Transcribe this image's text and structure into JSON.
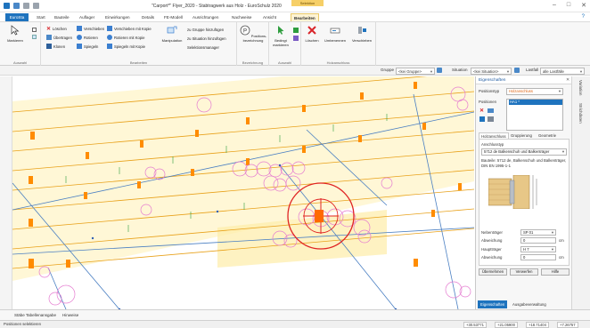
{
  "window": {
    "title": "\"Carport*\" Flyer_2020  -  Stabtragwerk aus Holz - EuroSchulz 2020",
    "context_tab_group": "Selektion"
  },
  "ribbon_tabs": [
    "EuroSta",
    "Start",
    "Bauteile",
    "Auflager",
    "Einwirkungen",
    "Details",
    "FE-Modell",
    "Ausrichtungen",
    "Nachweise",
    "Ansicht",
    "Bearbeiten"
  ],
  "ribbon": {
    "auswahl": {
      "markieren": "Markieren",
      "label": "Auswahl"
    },
    "bearbeiten": {
      "loeschen": "Löschen",
      "uebertragen": "Übertragen",
      "klonen": "Klonen",
      "verschieben": "Verschieben",
      "rotieren": "Rotieren",
      "spiegeln": "Spiegeln",
      "verschieben_kopie": "Verschieben mit Kopie",
      "rotieren_kopie": "Rotieren mit Kopie",
      "spiegeln_kopie": "Spiegeln mit Kopie",
      "manipulation": "Manipulation",
      "gruppe_hinzu": "zu Gruppe hinzufügen",
      "situation_hinzu": "zu Situation hinzufügen",
      "selektionsmanager": "Selektionsmanager",
      "label": "Bearbeiten"
    },
    "bezeichnung": {
      "positionsbezeichnung": "Positions-bezeichnung",
      "label": "Bezeichnung"
    },
    "auswahl2": {
      "bedingt_markieren": "Bedingt markieren",
      "label": "Auswahl"
    },
    "holzanschluss": {
      "loeschen": "Löschen",
      "umbenennen": "Umbenennen",
      "verschieben": "Verschieben",
      "label": "Holzanschluss"
    }
  },
  "filterbar": {
    "gruppe_label": "Gruppe",
    "gruppe_value": "<kei Gruppe>",
    "situation_label": "Situation",
    "situation_value": "<kei Situation>",
    "lastfall_label": "Lastfall",
    "lastfall_value": "alle Lastfälle"
  },
  "properties": {
    "title": "Eigenschaften",
    "positionstyp_label": "Positionstyp",
    "positionstyp_value": "Holzanschluss",
    "positionen_label": "Positionen",
    "positionen_value": "HA1 *",
    "subtabs": [
      "Holzanschluss",
      "Gruppierung",
      "Geometrie"
    ],
    "anschlusstyp_label": "Anschlusstyp",
    "anschlusstyp_value": "5712 de Balkenschuh und Balkenträger",
    "description": "Bauteile: 5712 de, Balkenschuh und Balkenträger, DIN EN 1995-1-1",
    "nebentraeger_label": "Nebenträger",
    "nebentraeger_value": "SP 01",
    "abweichung1_label": "Abweichung",
    "abweichung1_value": "0",
    "abweichung1_unit": "cm",
    "haupttraeger_label": "Hauptträger",
    "haupttraeger_value": "H 7",
    "abweichung2_label": "Abweichung",
    "abweichung2_value": "0",
    "abweichung2_unit": "cm",
    "btn_uebernehmen": "Übernehmen",
    "btn_verwerfen": "Verwerfen",
    "btn_hilfe": "Hilfe",
    "bottom_tabs": [
      "Eigenschaften",
      "Ausgabeverwaltung"
    ]
  },
  "right_strip": [
    "Variation",
    "Strichdaten"
  ],
  "view_tabs": [
    "Stäbe Tabellenansgabe",
    "Hinweise"
  ],
  "status": {
    "text": "Positionen selektieren",
    "coords": [
      "+30.53771",
      "+21.05900",
      "+18.71404",
      "+7.26757"
    ]
  },
  "colors": {
    "accent": "#1e73be",
    "context": "#f6cf67",
    "members": "#f5a623",
    "rafter": "#e8a11a",
    "selection": "#e02424",
    "circles": "#e57bd0",
    "bracket": "#ff8c00"
  }
}
